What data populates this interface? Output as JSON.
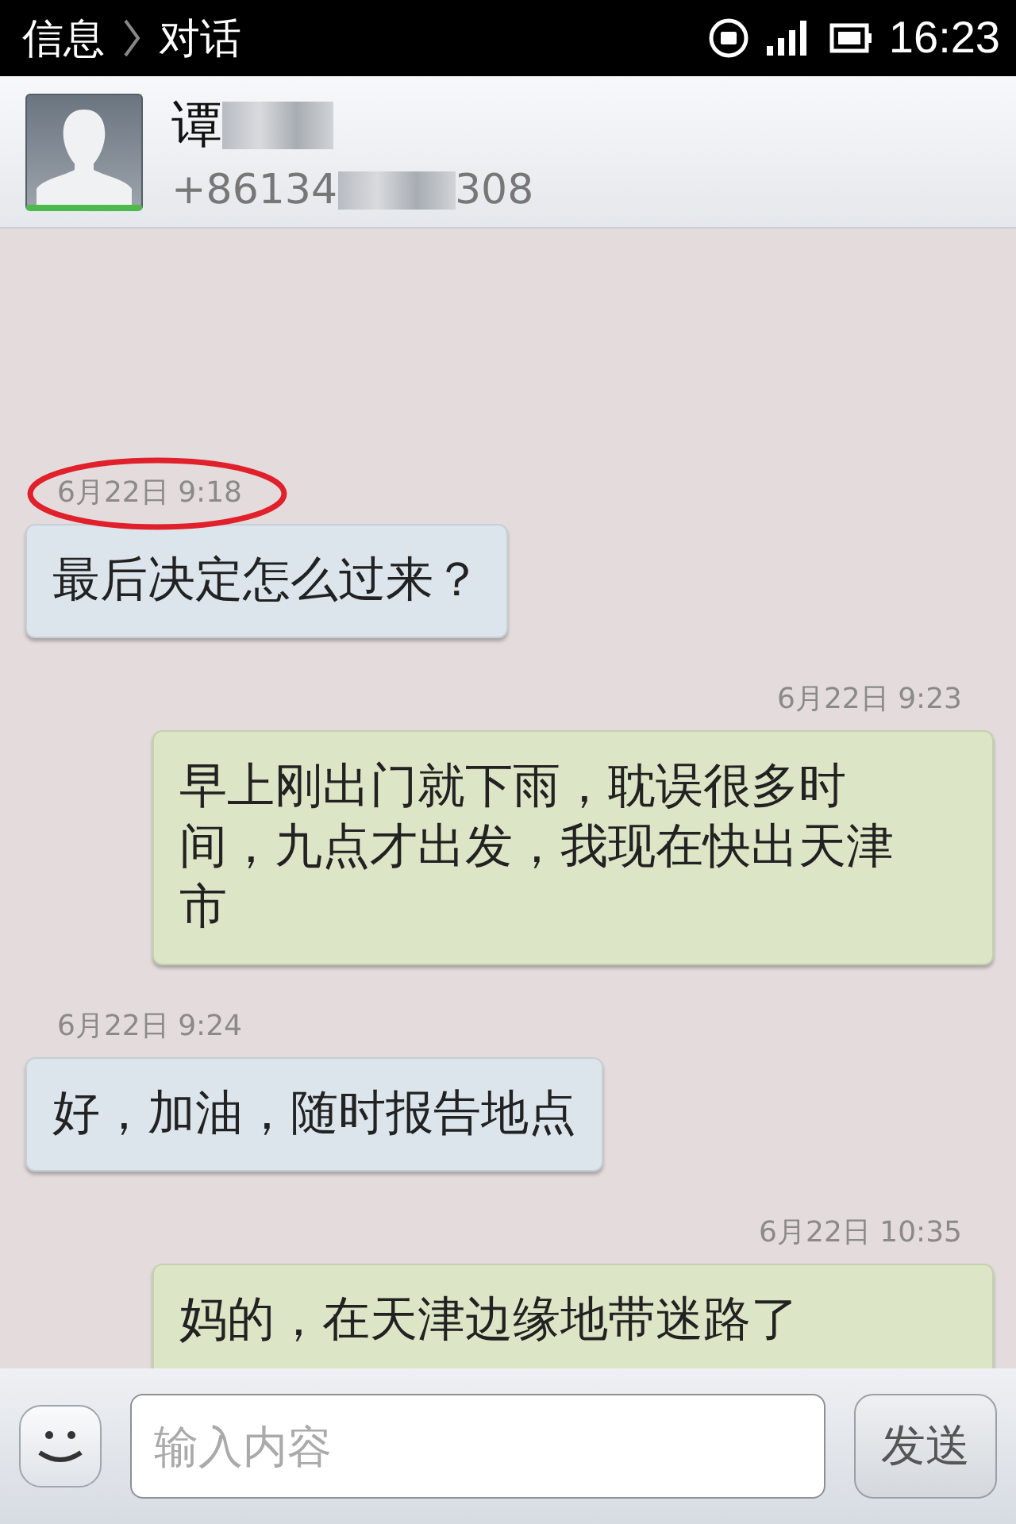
{
  "status_bar": {
    "breadcrumb": [
      "信息",
      "对话"
    ],
    "time": "16:23"
  },
  "contact": {
    "name": "谭",
    "name_blurred": true,
    "phone_start": "+86134",
    "phone_end": "308",
    "online": true
  },
  "messages": [
    {
      "kind": "incoming",
      "time": "6月22日 9:18",
      "text": "最后决定怎么过来？",
      "circled": true
    },
    {
      "kind": "outgoing",
      "time": "6月22日 9:23",
      "text": "早上刚出门就下雨，耽误很多时间，九点才出发，我现在快出天津市",
      "circled": false
    },
    {
      "kind": "incoming",
      "time": "6月22日 9:24",
      "text": "好，加油，随时报告地点",
      "circled": false
    },
    {
      "kind": "outgoing",
      "time": "6月22日 10:35",
      "text": "妈的，在天津边缘地带迷路了",
      "circled": false
    }
  ],
  "composer": {
    "placeholder": "输入内容",
    "send": "发送"
  }
}
